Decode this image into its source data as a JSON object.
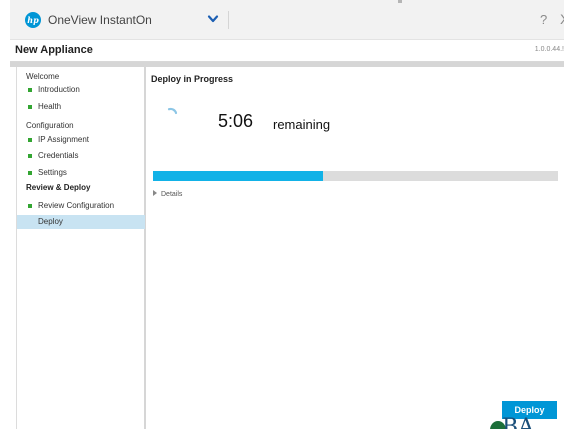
{
  "titlebar": {
    "logo_text": "hp",
    "app_title": "OneView InstantOn",
    "help": "?",
    "close": "X"
  },
  "dialog": {
    "title": "New Appliance",
    "version": "1.0.0.44.!"
  },
  "sidebar": {
    "sections": [
      {
        "label": "Welcome",
        "items": [
          {
            "label": "Introduction"
          },
          {
            "label": "Health"
          }
        ]
      },
      {
        "label": "Configuration",
        "items": [
          {
            "label": "IP Assignment"
          },
          {
            "label": "Credentials"
          },
          {
            "label": "Settings"
          }
        ]
      },
      {
        "label": "Review & Deploy",
        "items": [
          {
            "label": "Review Configuration"
          },
          {
            "label": "Deploy",
            "active": true
          }
        ]
      }
    ]
  },
  "main": {
    "title": "Deploy in Progress",
    "timer": "5:06",
    "remaining_label": "remaining",
    "progress_fraction": 0.42,
    "details_label": "Details"
  },
  "footer": {
    "deploy_label": "Deploy"
  },
  "colors": {
    "accent": "#0096d6",
    "progress": "#12b2e7",
    "status_complete": "#33a532",
    "selected_row": "#c8e3f2"
  },
  "icons": {
    "logo": "hp-logo-icon",
    "dropdown": "chevron-down-icon",
    "spinner": "loading-spinner-icon",
    "details": "expand-triangle-icon",
    "complete": "complete-square-icon"
  }
}
